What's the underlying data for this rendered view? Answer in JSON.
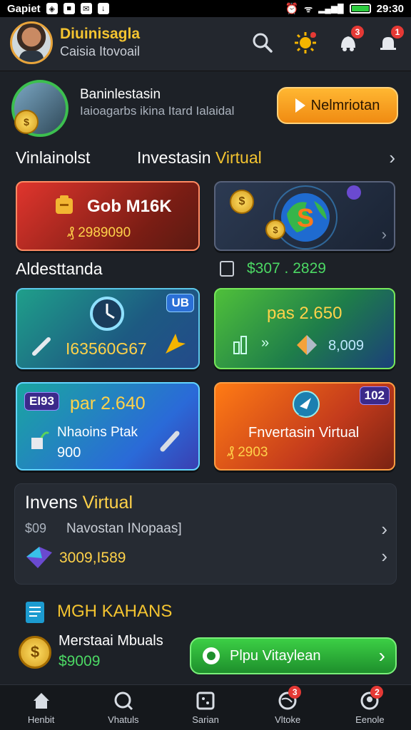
{
  "status_bar": {
    "left_text": "Gapiet",
    "time": "29:30"
  },
  "header": {
    "user_name": "Diuinisagla",
    "user_sub": "Caisia Itovoail",
    "badge_count_1": "3",
    "badge_count_2": "1"
  },
  "promo": {
    "title": "Baninlestasin",
    "subtitle": "Iaioagarbs ikina Itard Ialaidal",
    "button_label": "Nelmriotan"
  },
  "section1": {
    "left_title": "Vinlainolst",
    "title_main": "Investasin ",
    "title_highlight": "Virtual"
  },
  "card_red": {
    "title": "Gob M16K",
    "value": "2989090"
  },
  "section2": {
    "title": "Aldesttanda",
    "amount": "$307 . 2829"
  },
  "card_teal": {
    "tag": "UB",
    "value": "I63560G67"
  },
  "card_green": {
    "title": "pas 2.650",
    "value": "8,009"
  },
  "card_blue": {
    "tag": "EI93",
    "title": "par 2.640",
    "label": "Nhaoins Ptak",
    "value": "900"
  },
  "card_orange": {
    "tag": "102",
    "label": "Fnvertasin Virtual",
    "value": "2903"
  },
  "invest_panel": {
    "title_main": "Invens ",
    "title_highlight": "Virtual",
    "row1_code": "$09",
    "row1_label": "Navostan INopaas]",
    "row2_value": "3009,I589"
  },
  "bottom": {
    "title": "MGH KAHANS",
    "label": "Merstaai Mbuals",
    "amount": "$9009",
    "button_label": "Plpu Vitaylean"
  },
  "tabs": [
    {
      "label": "Henbit"
    },
    {
      "label": "Vhatuls"
    },
    {
      "label": "Sarian"
    },
    {
      "label": "Vltoke",
      "badge": "3"
    },
    {
      "label": "Eenole",
      "badge": "2"
    }
  ],
  "colors": {
    "accent_gold": "#f4c430",
    "accent_green": "#3cbf4f",
    "badge_red": "#e53935",
    "bg": "#1d2127"
  }
}
